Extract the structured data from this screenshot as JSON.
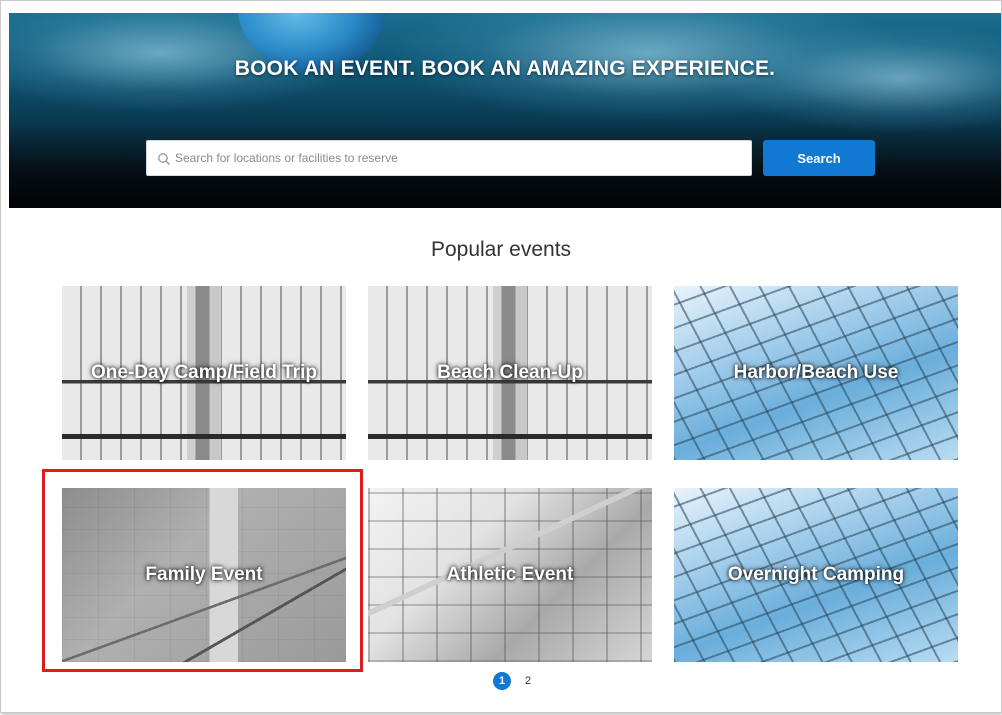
{
  "hero": {
    "title": "BOOK AN EVENT. BOOK AN AMAZING EXPERIENCE."
  },
  "search": {
    "placeholder": "Search for locations or facilities to reserve",
    "button_label": "Search",
    "icon": "search-icon"
  },
  "popular": {
    "title": "Popular events",
    "events": [
      {
        "label": "One-Day Camp/Field Trip",
        "image": "atrium-skylight"
      },
      {
        "label": "Beach Clean-Up",
        "image": "atrium-skylight"
      },
      {
        "label": "Harbor/Beach Use",
        "image": "glass-dome"
      },
      {
        "label": "Family Event",
        "image": "stone-stairs",
        "highlighted": true
      },
      {
        "label": "Athletic Event",
        "image": "skylight-interior"
      },
      {
        "label": "Overnight Camping",
        "image": "glass-dome"
      }
    ]
  },
  "pagination": {
    "pages": [
      "1",
      "2"
    ],
    "current": "1"
  },
  "colors": {
    "accent": "#1279d2",
    "highlight": "#dd1d1d"
  }
}
